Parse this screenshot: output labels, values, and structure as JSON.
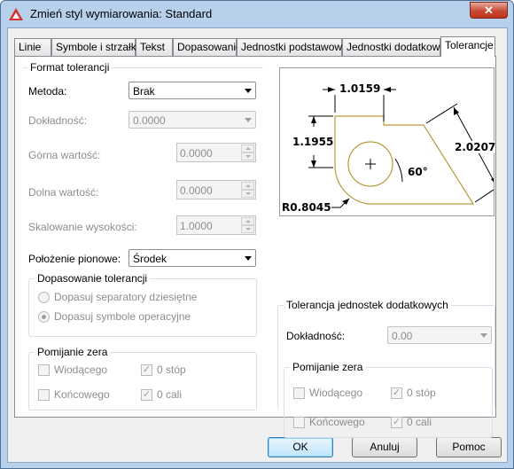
{
  "window": {
    "title": "Zmień styl wymiarowania: Standard",
    "close": "✕"
  },
  "tabs": [
    "Linie",
    "Symbole i strzałki",
    "Tekst",
    "Dopasowanie",
    "Jednostki podstawowe",
    "Jednostki dodatkowe",
    "Tolerancje"
  ],
  "format": {
    "group_title": "Format tolerancji",
    "method_label": "Metoda:",
    "method_value": "Brak",
    "precision_label": "Dokładność:",
    "precision_value": "0.0000",
    "upper_label": "Górna wartość:",
    "upper_value": "0.0000",
    "lower_label": "Dolna wartość:",
    "lower_value": "0.0000",
    "scale_label": "Skalowanie wysokości:",
    "scale_value": "1.0000",
    "vpos_label": "Położenie pionowe:",
    "vpos_value": "Środek"
  },
  "alignment": {
    "group_title": "Dopasowanie tolerancji",
    "opt1": "Dopasuj separatory dziesiętne",
    "opt2": "Dopasuj symbole operacyjne",
    "selected": 2
  },
  "zero_left": {
    "group_title": "Pomijanie zera",
    "leading": "Wiodącego",
    "trailing": "Końcowego",
    "feet": "0 stóp",
    "inches": "0 cali",
    "leading_checked": false,
    "trailing_checked": false,
    "feet_checked": true,
    "inches_checked": true
  },
  "alt_tol": {
    "group_title": "Tolerancja jednostek dodatkowych",
    "precision_label": "Dokładność:",
    "precision_value": "0.00"
  },
  "zero_right": {
    "group_title": "Pomijanie zera",
    "leading": "Wiodącego",
    "trailing": "Końcowego",
    "feet": "0 stóp",
    "inches": "0 cali",
    "leading_checked": false,
    "trailing_checked": false,
    "feet_checked": true,
    "inches_checked": true
  },
  "preview": {
    "dim_top": "1.0159",
    "dim_left": "1.1955",
    "dim_right": "2.0207",
    "angle": "60°",
    "radius": "R0.8045"
  },
  "buttons": {
    "ok": "OK",
    "cancel": "Anuluj",
    "help": "Pomoc"
  },
  "colors": {
    "accent_icon": "#d8302a",
    "preview_geometry": "#b89a3c"
  }
}
